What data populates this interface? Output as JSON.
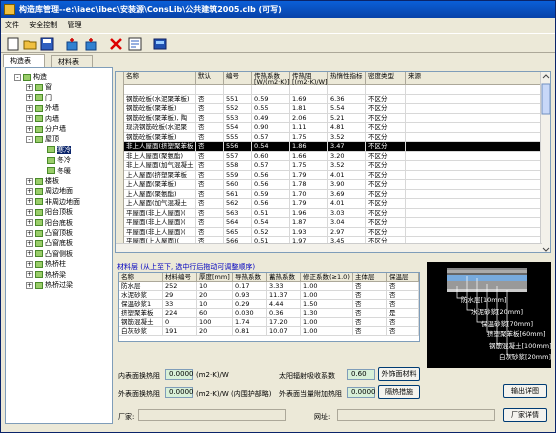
{
  "window": {
    "title": "构造库管理--e:\\iaec\\ibec\\安装源\\ConsLib\\公共建筑2005.clb (可写)"
  },
  "menu": [
    "文件",
    "安全控制",
    "管理"
  ],
  "tabs": [
    "构造表",
    "材料表"
  ],
  "tree": [
    {
      "label": "构造",
      "level": 0,
      "toggle": "-"
    },
    {
      "label": "窗",
      "level": 1,
      "toggle": "+"
    },
    {
      "label": "门",
      "level": 1,
      "toggle": "+"
    },
    {
      "label": "外墙",
      "level": 1,
      "toggle": "+"
    },
    {
      "label": "内墙",
      "level": 1,
      "toggle": "+"
    },
    {
      "label": "分户墙",
      "level": 1,
      "toggle": "+"
    },
    {
      "label": "屋顶",
      "level": 1,
      "toggle": "-"
    },
    {
      "label": "寒冷",
      "level": 2,
      "toggle": "",
      "selected": true
    },
    {
      "label": "冬冷",
      "level": 2,
      "toggle": ""
    },
    {
      "label": "冬暖",
      "level": 2,
      "toggle": ""
    },
    {
      "label": "楼板",
      "level": 1,
      "toggle": "+"
    },
    {
      "label": "周边地面",
      "level": 1,
      "toggle": "+"
    },
    {
      "label": "非周边地面",
      "level": 1,
      "toggle": "+"
    },
    {
      "label": "阳台顶板",
      "level": 1,
      "toggle": "+"
    },
    {
      "label": "阳台底板",
      "level": 1,
      "toggle": "+"
    },
    {
      "label": "凸窗顶板",
      "level": 1,
      "toggle": "+"
    },
    {
      "label": "凸窗底板",
      "level": 1,
      "toggle": "+"
    },
    {
      "label": "凸窗侧板",
      "level": 1,
      "toggle": "+"
    },
    {
      "label": "热桥柱",
      "level": 1,
      "toggle": "+"
    },
    {
      "label": "热桥梁",
      "level": 1,
      "toggle": "+"
    },
    {
      "label": "热桥过梁",
      "level": 1,
      "toggle": "+"
    }
  ],
  "grid": {
    "headers": [
      "名称",
      "默认",
      "编号",
      "传热系数 [W/(m2·K)]",
      "传热阻 [(m2·K)/W]",
      "热惰性指标",
      "密度类型",
      "来源"
    ],
    "rows": [
      [
        "",
        "",
        "",
        "",
        "",
        "",
        "",
        ""
      ],
      [
        "钢筋砼板(水泥聚苯板)",
        "否",
        "551",
        "0.59",
        "1.69",
        "6.36",
        "不区分",
        ""
      ],
      [
        "钢筋砼板(聚苯板)",
        "否",
        "552",
        "0.55",
        "1.81",
        "5.54",
        "不区分",
        ""
      ],
      [
        "钢筋砼板(聚苯板), 陶",
        "否",
        "553",
        "0.49",
        "2.06",
        "5.21",
        "不区分",
        ""
      ],
      [
        "现浇钢筋砼板(水泥聚",
        "否",
        "554",
        "0.90",
        "1.11",
        "4.81",
        "不区分",
        ""
      ],
      [
        "钢筋砼板(聚苯板)",
        "否",
        "555",
        "0.57",
        "1.75",
        "3.52",
        "不区分",
        ""
      ],
      [
        "非上人屋面(挤塑聚苯板",
        "否",
        "556",
        "0.54",
        "1.86",
        "3.47",
        "不区分",
        ""
      ],
      [
        "非上人屋面(聚氨酯)",
        "否",
        "557",
        "0.60",
        "1.66",
        "3.20",
        "不区分",
        ""
      ],
      [
        "非上人屋面(加气混凝土",
        "否",
        "558",
        "0.57",
        "1.75",
        "3.52",
        "不区分",
        ""
      ],
      [
        "上人屋面(挤塑聚苯板",
        "否",
        "559",
        "0.56",
        "1.79",
        "4.01",
        "不区分",
        ""
      ],
      [
        "上人屋面(聚苯板)",
        "否",
        "560",
        "0.56",
        "1.78",
        "3.90",
        "不区分",
        ""
      ],
      [
        "上人屋面(聚氨酯)",
        "否",
        "561",
        "0.59",
        "1.70",
        "3.69",
        "不区分",
        ""
      ],
      [
        "上人屋面(加气混凝土",
        "否",
        "562",
        "0.56",
        "1.79",
        "4.01",
        "不区分",
        ""
      ],
      [
        "平屋面(非上人屋面)(",
        "否",
        "563",
        "0.51",
        "1.96",
        "3.03",
        "不区分",
        ""
      ],
      [
        "平屋面(非上人屋面)(",
        "否",
        "564",
        "0.54",
        "1.87",
        "3.04",
        "不区分",
        ""
      ],
      [
        "平屋面(非上人屋面)(",
        "否",
        "565",
        "0.52",
        "1.93",
        "2.97",
        "不区分",
        ""
      ],
      [
        "平屋面(上人屋面)(",
        "否",
        "566",
        "0.51",
        "1.97",
        "3.45",
        "不区分",
        ""
      ]
    ],
    "selected_row": 6
  },
  "layer_hint": "材料层 (从上至下, 选中行后拖动可调整顺序)",
  "layers": {
    "headers": [
      "名称",
      "材料编号",
      "厚度[mm]",
      "导热系数",
      "蓄热系数",
      "修正系数(≥1.0)",
      "主体层",
      "保温层"
    ],
    "rows": [
      [
        "防水层",
        "252",
        "10",
        "0.17",
        "3.33",
        "1.00",
        "否",
        "否"
      ],
      [
        "水泥砂浆",
        "29",
        "20",
        "0.93",
        "11.37",
        "1.00",
        "否",
        "否"
      ],
      [
        "保温砂浆1",
        "33",
        "10",
        "0.29",
        "4.44",
        "1.50",
        "否",
        "否"
      ],
      [
        "挤塑聚苯板",
        "224",
        "60",
        "0.030",
        "0.36",
        "1.30",
        "否",
        "是"
      ],
      [
        "钢筋混凝土",
        "0",
        "100",
        "1.74",
        "17.20",
        "1.00",
        "否",
        "否"
      ],
      [
        "白灰砂浆",
        "191",
        "20",
        "0.81",
        "10.07",
        "1.00",
        "否",
        "否"
      ]
    ]
  },
  "preview": {
    "labels": [
      "防水层[10mm]",
      "水泥砂浆[20mm]",
      "保温砂浆[70mm]",
      "挤塑聚苯板[60mm]",
      "钢筋混凝土[100mm]",
      "白灰砂浆[20mm]"
    ]
  },
  "bottom": {
    "inner_label": "内表面换热阻",
    "inner_value": "0.0000",
    "inner_unit": "(m2·K)/W",
    "outer_label": "外表面换热阻",
    "outer_value": "0.0000",
    "outer_unit": "(m2·K)/W (内围护部略)",
    "solar_label": "太阳辐射吸收系数",
    "solar_value": "0.60",
    "ext_mat_btn": "外饰面材料",
    "outer_equiv_label": "外表面当量附加热阻",
    "outer_equiv_value": "0.0000",
    "shading_btn": "隔热措施",
    "export_btn": "输出详图",
    "vendor_label": "厂家:",
    "url_label": "网址:",
    "vendor_detail_btn": "厂家详情"
  }
}
